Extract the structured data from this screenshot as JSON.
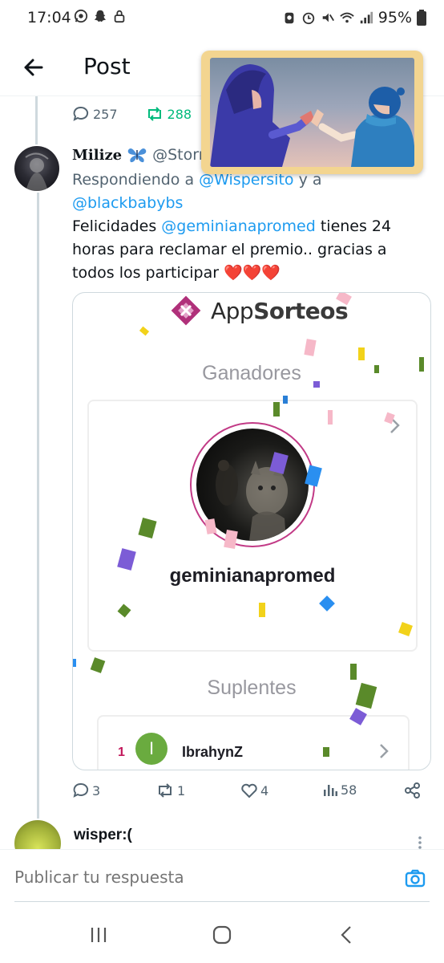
{
  "status_bar": {
    "time": "17:04",
    "battery": "95%"
  },
  "header": {
    "title": "Post"
  },
  "parent_post": {
    "replies": "257",
    "reposts": "288"
  },
  "reply": {
    "name": "Milize",
    "handle": "@Storm",
    "replying_prefix": "Respondiendo a",
    "replying_to_1": "@Wispersito",
    "replying_conj": "y a",
    "replying_to_2": "@blackbabybs",
    "text_before": "Felicidades",
    "text_mention": "@geminianapromed",
    "text_after": "tienes 24 horas para reclamar el premio.. gracias a todos los participar",
    "emoji": "❤️❤️❤️",
    "stats": {
      "replies": "3",
      "reposts": "1",
      "likes": "4",
      "views": "58"
    }
  },
  "card": {
    "brand_app": "App",
    "brand_sorteos": "Sorteos",
    "winners_title": "Ganadores",
    "winner_name": "geminianapromed",
    "substitutes_title": "Suplentes",
    "substitute": {
      "rank": "1",
      "initial": "I",
      "name": "IbrahynZ"
    }
  },
  "next_post": {
    "name": "wisper:("
  },
  "reply_box": {
    "placeholder": "Publicar tu respuesta"
  },
  "colors": {
    "accent": "#1d9bf0",
    "repost_green": "#00ba7c",
    "brand_magenta": "#c2185b",
    "heart_red": "#e0245e"
  }
}
